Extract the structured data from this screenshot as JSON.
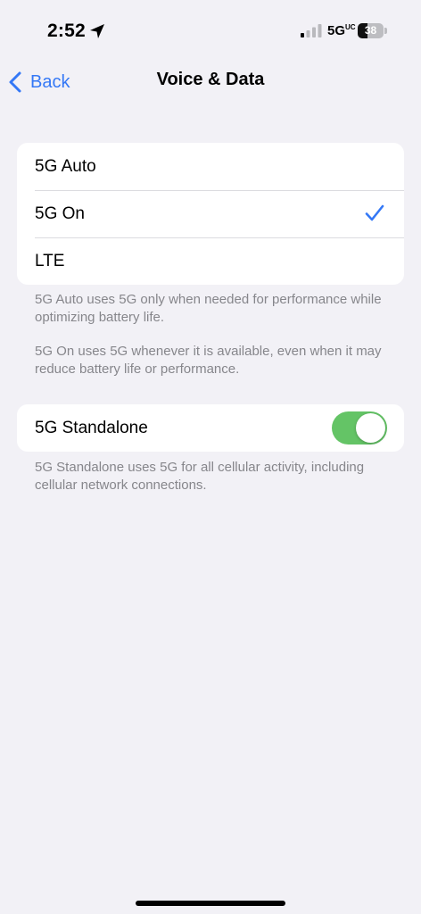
{
  "status_bar": {
    "time": "2:52",
    "network": "5G",
    "network_suffix": "UC",
    "battery_percent": "38",
    "battery_level": 0.38,
    "location_icon": "location-arrow-icon",
    "signal_icon": "signal-bars-icon"
  },
  "nav": {
    "back_label": "Back",
    "title": "Voice & Data"
  },
  "voice_data_options": {
    "items": [
      {
        "label": "5G Auto",
        "selected": false
      },
      {
        "label": "5G On",
        "selected": true
      },
      {
        "label": "LTE",
        "selected": false
      }
    ]
  },
  "footnotes": {
    "auto": "5G Auto uses 5G only when needed for performance while optimizing battery life.",
    "on": "5G On uses 5G whenever it is available, even when it may reduce battery life or performance.",
    "standalone": "5G Standalone uses 5G for all cellular activity, including cellular network connections."
  },
  "standalone": {
    "label": "5G Standalone",
    "enabled": true
  },
  "colors": {
    "accent": "#3478f6",
    "toggle_on": "#64c466",
    "background": "#f2f1f6"
  }
}
